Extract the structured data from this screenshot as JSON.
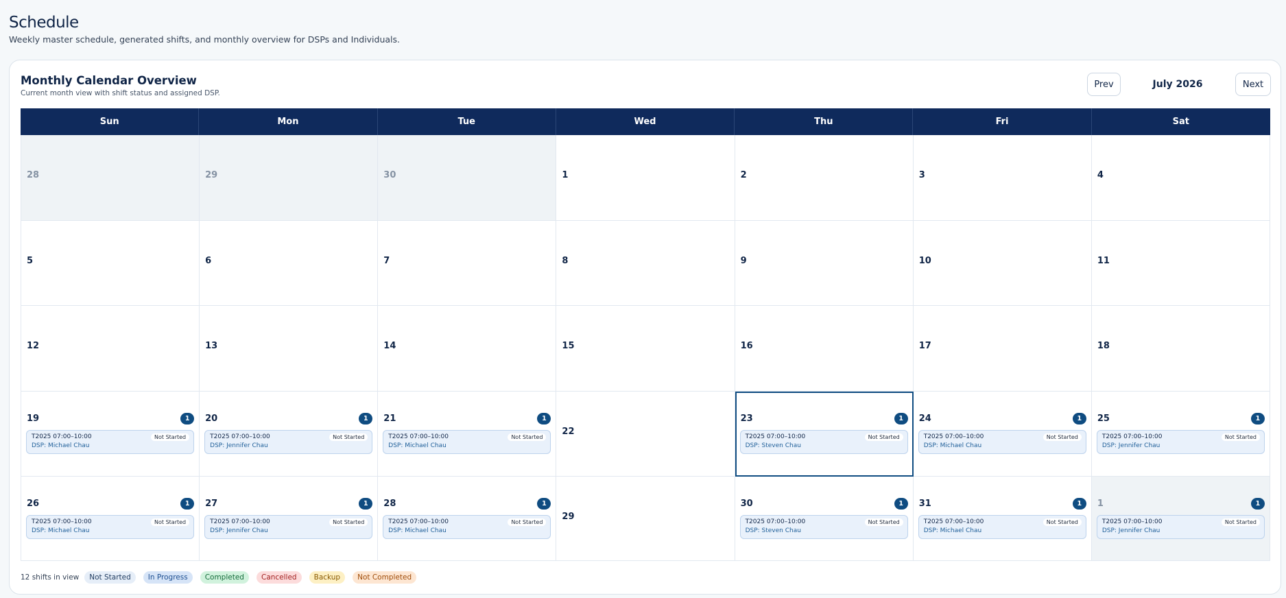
{
  "page": {
    "title": "Schedule",
    "subtitle": "Weekly master schedule, generated shifts, and monthly overview for DSPs and Individuals."
  },
  "card": {
    "title": "Monthly Calendar Overview",
    "subtitle": "Current month view with shift status and assigned DSP."
  },
  "nav": {
    "prev_label": "Prev",
    "next_label": "Next",
    "month_label": "July 2026"
  },
  "weekdays": [
    "Sun",
    "Mon",
    "Tue",
    "Wed",
    "Thu",
    "Fri",
    "Sat"
  ],
  "weeks": [
    [
      {
        "day": "28",
        "outside": true
      },
      {
        "day": "29",
        "outside": true
      },
      {
        "day": "30",
        "outside": true
      },
      {
        "day": "1"
      },
      {
        "day": "2"
      },
      {
        "day": "3"
      },
      {
        "day": "4"
      }
    ],
    [
      {
        "day": "5"
      },
      {
        "day": "6"
      },
      {
        "day": "7"
      },
      {
        "day": "8"
      },
      {
        "day": "9"
      },
      {
        "day": "10"
      },
      {
        "day": "11"
      }
    ],
    [
      {
        "day": "12"
      },
      {
        "day": "13"
      },
      {
        "day": "14"
      },
      {
        "day": "15"
      },
      {
        "day": "16"
      },
      {
        "day": "17"
      },
      {
        "day": "18"
      }
    ],
    [
      {
        "day": "19",
        "count": "1",
        "shift": {
          "time": "T2025 07:00–10:00",
          "status": "Not Started",
          "dsp": "DSP: Michael Chau"
        }
      },
      {
        "day": "20",
        "count": "1",
        "shift": {
          "time": "T2025 07:00–10:00",
          "status": "Not Started",
          "dsp": "DSP: Jennifer Chau"
        }
      },
      {
        "day": "21",
        "count": "1",
        "shift": {
          "time": "T2025 07:00–10:00",
          "status": "Not Started",
          "dsp": "DSP: Michael Chau"
        }
      },
      {
        "day": "22"
      },
      {
        "day": "23",
        "selected": true,
        "count": "1",
        "shift": {
          "time": "T2025 07:00–10:00",
          "status": "Not Started",
          "dsp": "DSP: Steven Chau"
        }
      },
      {
        "day": "24",
        "count": "1",
        "shift": {
          "time": "T2025 07:00–10:00",
          "status": "Not Started",
          "dsp": "DSP: Michael Chau"
        }
      },
      {
        "day": "25",
        "count": "1",
        "shift": {
          "time": "T2025 07:00–10:00",
          "status": "Not Started",
          "dsp": "DSP: Jennifer Chau"
        }
      }
    ],
    [
      {
        "day": "26",
        "count": "1",
        "shift": {
          "time": "T2025 07:00–10:00",
          "status": "Not Started",
          "dsp": "DSP: Michael Chau"
        }
      },
      {
        "day": "27",
        "count": "1",
        "shift": {
          "time": "T2025 07:00–10:00",
          "status": "Not Started",
          "dsp": "DSP: Jennifer Chau"
        }
      },
      {
        "day": "28",
        "count": "1",
        "shift": {
          "time": "T2025 07:00–10:00",
          "status": "Not Started",
          "dsp": "DSP: Michael Chau"
        }
      },
      {
        "day": "29"
      },
      {
        "day": "30",
        "count": "1",
        "shift": {
          "time": "T2025 07:00–10:00",
          "status": "Not Started",
          "dsp": "DSP: Steven Chau"
        }
      },
      {
        "day": "31",
        "count": "1",
        "shift": {
          "time": "T2025 07:00–10:00",
          "status": "Not Started",
          "dsp": "DSP: Michael Chau"
        }
      },
      {
        "day": "1",
        "outside": true,
        "count": "1",
        "shift": {
          "time": "T2025 07:00–10:00",
          "status": "Not Started",
          "dsp": "DSP: Jennifer Chau"
        }
      }
    ]
  ],
  "legend": {
    "count_text": "12 shifts in view",
    "items": [
      {
        "label": "Not Started",
        "key": "not-started"
      },
      {
        "label": "In Progress",
        "key": "in-progress"
      },
      {
        "label": "Completed",
        "key": "completed"
      },
      {
        "label": "Cancelled",
        "key": "cancelled"
      },
      {
        "label": "Backup",
        "key": "backup"
      },
      {
        "label": "Not Completed",
        "key": "not-completed"
      }
    ]
  },
  "colors": {
    "header_navy": "#0f2a5c",
    "badge_blue": "#0f4c81",
    "selected_outline": "#0f4c81"
  }
}
